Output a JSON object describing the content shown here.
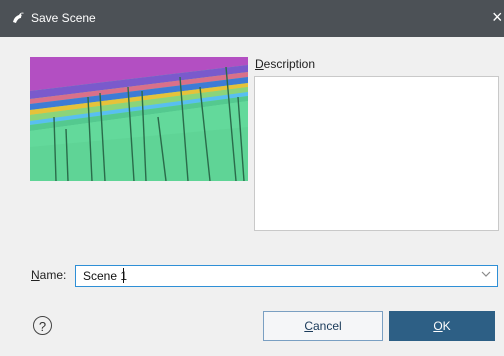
{
  "window": {
    "title": "Save Scene",
    "close_glyph": "×"
  },
  "icons": {
    "app": "leapfrog-app-icon",
    "help": "help-icon",
    "dropdown": "chevron-down-icon"
  },
  "colors": {
    "titlebar": "#4c5156",
    "ok_button": "#2d5f85",
    "focus_border": "#2e8fd6"
  },
  "description": {
    "label_mnemonic": "D",
    "label_rest": "escription",
    "value": ""
  },
  "name": {
    "label_mnemonic": "N",
    "label_rest": "ame:",
    "value": "Scene 1"
  },
  "buttons": {
    "help_glyph": "?",
    "cancel_mnemonic": "C",
    "cancel_rest": "ancel",
    "ok_mnemonic": "O",
    "ok_rest": "K"
  }
}
